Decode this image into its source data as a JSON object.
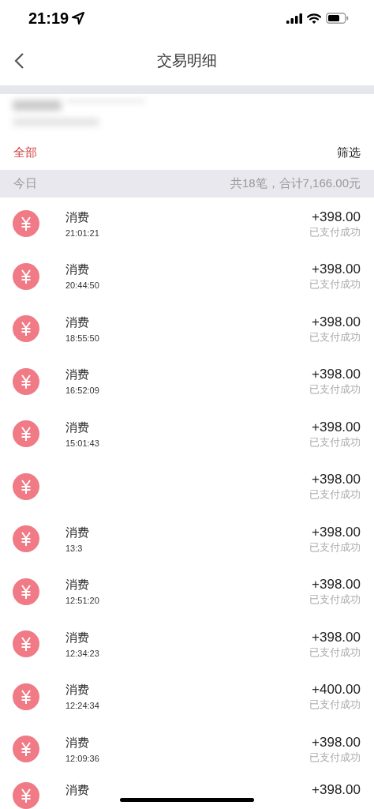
{
  "status_bar": {
    "time": "21:19"
  },
  "nav": {
    "title": "交易明细"
  },
  "filter_bar": {
    "all_label": "全部",
    "filter_label": "筛选"
  },
  "section": {
    "label": "今日",
    "summary": "共18笔，合计7,166.00元"
  },
  "transactions": [
    {
      "title": "消费",
      "time": "21:01:21",
      "amount": "+398.00",
      "status": "已支付成功"
    },
    {
      "title": "消费",
      "time": "20:44:50",
      "amount": "+398.00",
      "status": "已支付成功"
    },
    {
      "title": "消费",
      "time": "18:55:50",
      "amount": "+398.00",
      "status": "已支付成功"
    },
    {
      "title": "消费",
      "time": "16:52:09",
      "amount": "+398.00",
      "status": "已支付成功"
    },
    {
      "title": "消费",
      "time": "15:01:43",
      "amount": "+398.00",
      "status": "已支付成功"
    },
    {
      "amount": "+398.00",
      "status": "已支付成功"
    },
    {
      "title": "消费",
      "time": "13:3",
      "amount": "+398.00",
      "status": "已支付成功"
    },
    {
      "title": "消费",
      "time": "12:51:20",
      "amount": "+398.00",
      "status": "已支付成功"
    },
    {
      "title": "消费",
      "time": "12:34:23",
      "amount": "+398.00",
      "status": "已支付成功"
    },
    {
      "title": "消费",
      "time": "12:24:34",
      "amount": "+400.00",
      "status": "已支付成功"
    },
    {
      "title": "消费",
      "time": "12:09:36",
      "amount": "+398.00",
      "status": "已支付成功"
    },
    {
      "title": "消费",
      "amount": "+398.00"
    }
  ]
}
